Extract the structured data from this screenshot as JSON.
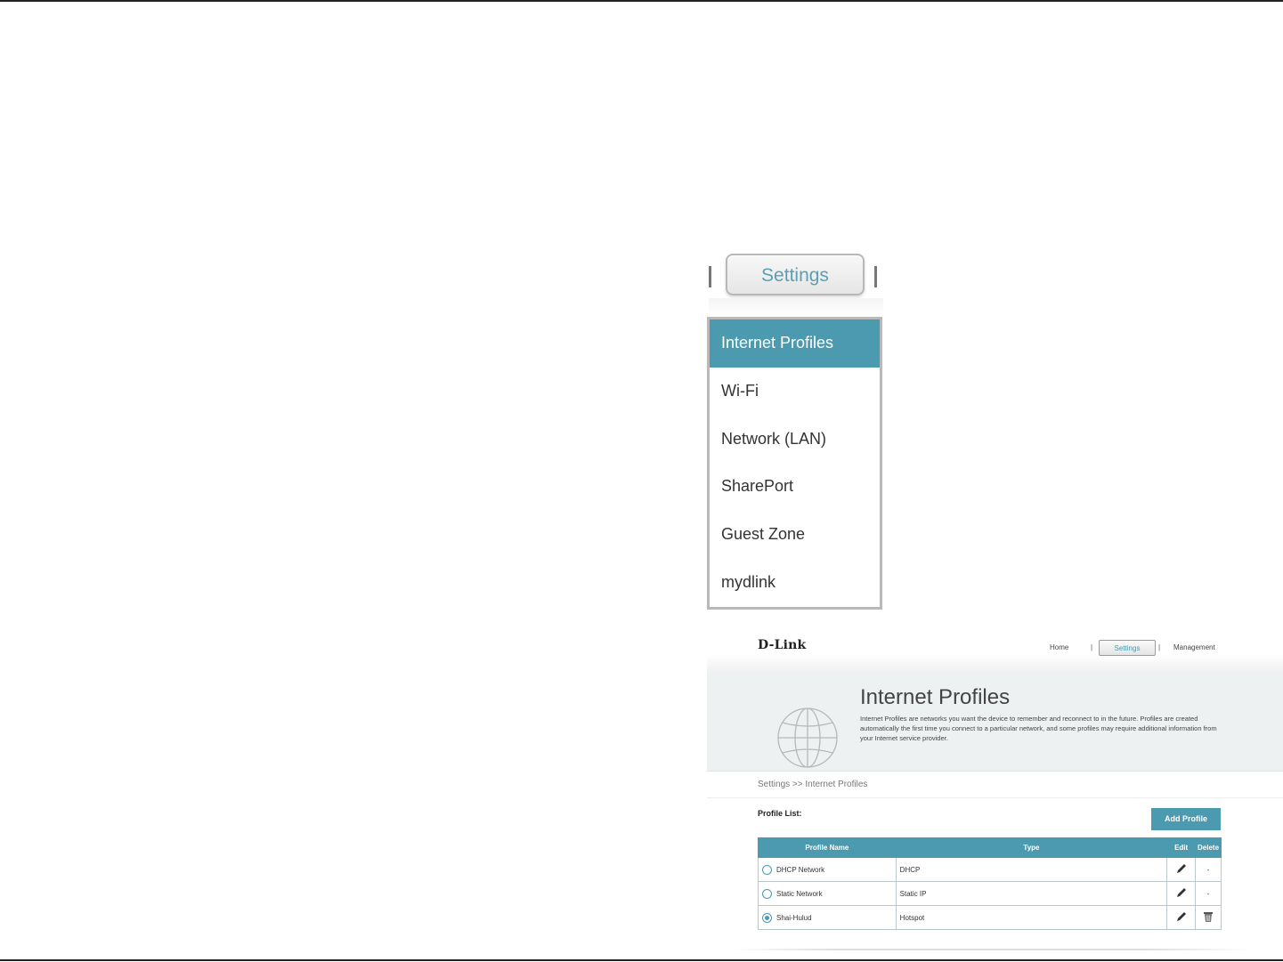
{
  "zoom": {
    "tab_label": "Settings",
    "menu_items": [
      "Internet Profiles",
      "Wi-Fi",
      "Network (LAN)",
      "SharePort",
      "Guest Zone",
      "mydlink"
    ]
  },
  "mini": {
    "logo": "D-Link",
    "nav": {
      "home": "Home",
      "sep": "|",
      "settings": "Settings",
      "management": "Management"
    },
    "banner": {
      "title": "Internet Profiles",
      "description": "Internet Profiles are networks you want the device to remember and reconnect to in the future. Profiles are created automatically the first time you connect to a particular network, and some profiles may require additional information from your Internet service provider."
    },
    "breadcrumb": "Settings >> Internet Profiles",
    "profile_list_label": "Profile List:",
    "add_button": "Add Profile",
    "table": {
      "headers": {
        "name": "Profile Name",
        "type": "Type",
        "edit": "Edit",
        "delete": "Delete"
      },
      "rows": [
        {
          "name": "DHCP Network",
          "type": "DHCP",
          "delete": "-"
        },
        {
          "name": "Static Network",
          "type": "Static IP",
          "delete": "-"
        },
        {
          "name": "Shai-Hulud",
          "type": "Hotspot",
          "delete": ""
        }
      ]
    }
  },
  "colors": {
    "accent": "#4b9aaf",
    "banner_bg": "#eef1f2"
  },
  "icons": [
    "pencil-icon",
    "trash-icon",
    "globe-icon",
    "radio-icon"
  ]
}
